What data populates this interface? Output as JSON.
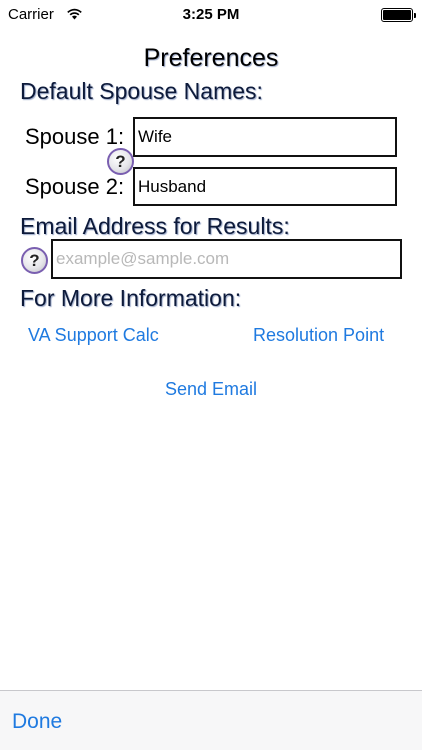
{
  "status_bar": {
    "carrier": "Carrier",
    "time": "3:25 PM",
    "icons": [
      "wifi-icon",
      "battery-icon"
    ]
  },
  "title": "Preferences",
  "spouse_section": {
    "heading": "Default Spouse Names:",
    "spouse1_label": "Spouse 1:",
    "spouse1_value": "Wife",
    "spouse2_label": "Spouse 2:",
    "spouse2_value": "Husband"
  },
  "email_section": {
    "heading": "Email Address for Results:",
    "placeholder": "example@sample.com"
  },
  "info_section": {
    "heading": "For More Information:",
    "va_link": "VA Support Calc",
    "rp_link": "Resolution Point",
    "send_email": "Send Email"
  },
  "help_icon_glyph": "?",
  "toolbar": {
    "done_label": "Done"
  },
  "colors": {
    "link": "#1f7ae0",
    "heading": "#0d1a3a",
    "help_border": "#7a5fb0"
  }
}
